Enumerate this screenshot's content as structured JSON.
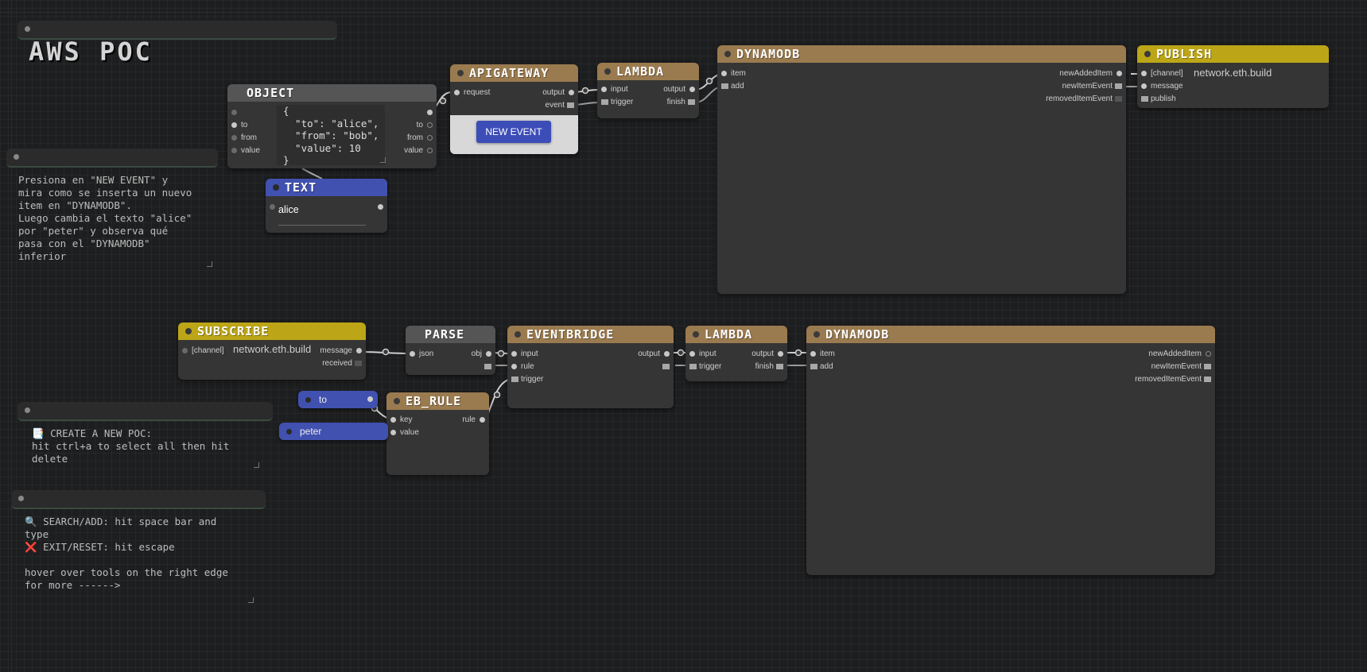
{
  "title_bar": {
    "title": "AWS POC"
  },
  "notes": {
    "instructions": "Presiona en \"NEW EVENT\" y\nmira como se inserta un nuevo\nitem en \"DYNAMODB\".\nLuego cambia el texto \"alice\"\npor \"peter\" y observa qué\npasa con el \"DYNAMODB\"\ninferior",
    "create_poc": "📑 CREATE A NEW POC:\nhit ctrl+a to select all then hit\ndelete",
    "help": "🔍 SEARCH/ADD: hit space bar and\ntype\n❌ EXIT/RESET: hit escape\n\nhover over tools on the right edge\nfor more ------>"
  },
  "object_node": {
    "title": "OBJECT",
    "inputs": [
      "to",
      "from",
      "value"
    ],
    "outputs": [
      "to",
      "from",
      "value"
    ],
    "json_text": "{\n  \"to\": \"alice\",\n  \"from\": \"bob\",\n  \"value\": 10\n}"
  },
  "text_node": {
    "title": "TEXT",
    "value": "alice"
  },
  "apigateway_node": {
    "title": "APIGATEWAY",
    "input": "request",
    "outputs": [
      "output",
      "event"
    ],
    "button_label": "NEW EVENT"
  },
  "lambda_top": {
    "title": "LAMBDA",
    "inputs": [
      "input",
      "trigger"
    ],
    "outputs": [
      "output",
      "finish"
    ]
  },
  "dynamodb_top": {
    "title": "DYNAMODB",
    "inputs": [
      "item",
      "add"
    ],
    "outputs": [
      "newAddedItem",
      "newItemEvent",
      "removedItemEvent"
    ]
  },
  "publish_node": {
    "title": "PUBLISH",
    "inputs": [
      "[channel]",
      "message",
      "publish"
    ],
    "channel": "network.eth.build"
  },
  "subscribe_node": {
    "title": "SUBSCRIBE",
    "input": "[channel]",
    "channel": "network.eth.build",
    "outputs": [
      "message",
      "received"
    ]
  },
  "parse_node": {
    "title": "PARSE",
    "input": "json",
    "output": "obj"
  },
  "eventbridge_node": {
    "title": "EVENTBRIDGE",
    "inputs": [
      "input",
      "rule",
      "trigger"
    ],
    "output": "output"
  },
  "lambda_bottom": {
    "title": "LAMBDA",
    "inputs": [
      "input",
      "trigger"
    ],
    "outputs": [
      "output",
      "finish"
    ]
  },
  "dynamodb_bottom": {
    "title": "DYNAMODB",
    "inputs": [
      "item",
      "add"
    ],
    "outputs": [
      "newAddedItem",
      "newItemEvent",
      "removedItemEvent"
    ]
  },
  "eb_rule_node": {
    "title": "EB_RULE",
    "inputs": [
      "key",
      "value"
    ],
    "output": "rule"
  },
  "pills": {
    "to": "to",
    "peter": "peter"
  },
  "colors": {
    "background": "#1d1e1f",
    "node_body": "#353535",
    "header_brown": "#9a7a4f",
    "header_gray": "#555555",
    "header_blue": "#4151b0",
    "header_yellow": "#bca617",
    "button_blue": "#3d4db8"
  }
}
